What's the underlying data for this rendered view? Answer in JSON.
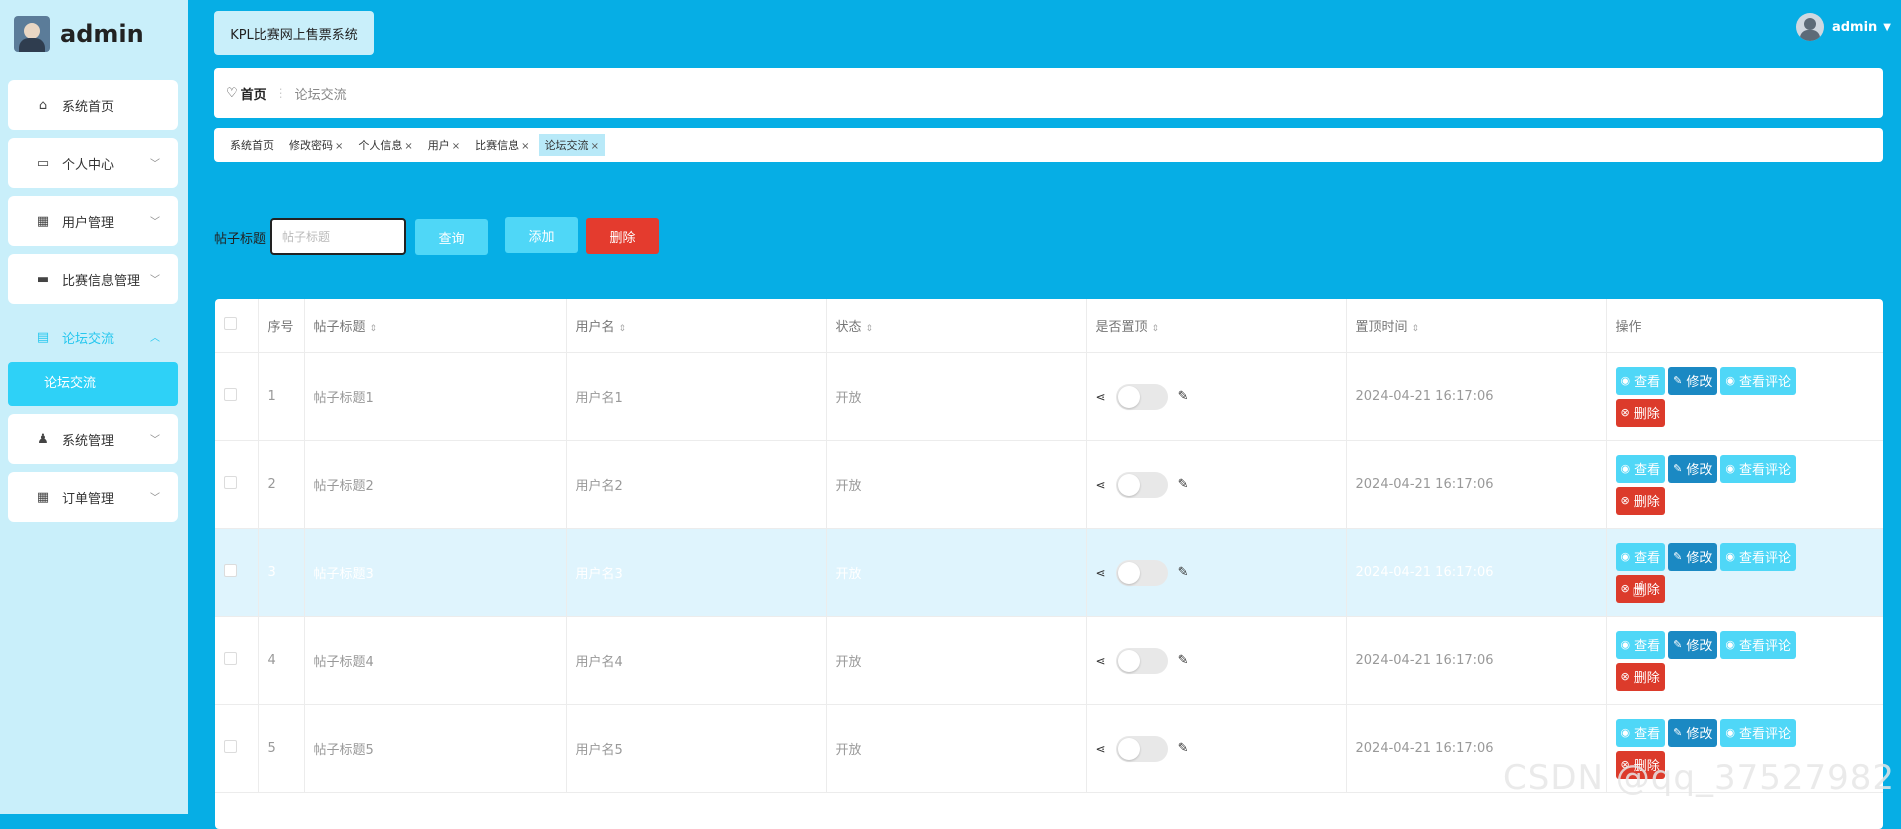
{
  "brand": {
    "name": "admin"
  },
  "sidebar": {
    "items": [
      {
        "label": "系统首页",
        "icon": "home-icon"
      },
      {
        "label": "个人中心",
        "icon": "wallet-icon",
        "arrow": "chevron-down-icon"
      },
      {
        "label": "用户管理",
        "icon": "grid-icon",
        "arrow": "chevron-down-icon"
      },
      {
        "label": "比赛信息管理",
        "icon": "briefcase-icon",
        "arrow": "chevron-down-icon"
      },
      {
        "label": "论坛交流",
        "icon": "clipboard-icon",
        "arrow": "chevron-up-icon"
      },
      {
        "label": "系统管理",
        "icon": "user-icon",
        "arrow": "chevron-down-icon"
      },
      {
        "label": "订单管理",
        "icon": "grid-icon",
        "arrow": "chevron-down-icon"
      }
    ],
    "submenu": {
      "label": "论坛交流"
    }
  },
  "header": {
    "system_title": "KPL比赛网上售票系统",
    "user": "admin"
  },
  "breadcrumb": {
    "home": "首页",
    "current": "论坛交流"
  },
  "tags": [
    {
      "label": "系统首页",
      "closable": false
    },
    {
      "label": "修改密码",
      "closable": true
    },
    {
      "label": "个人信息",
      "closable": true
    },
    {
      "label": "用户",
      "closable": true
    },
    {
      "label": "比赛信息",
      "closable": true
    },
    {
      "label": "论坛交流",
      "closable": true,
      "active": true
    }
  ],
  "search": {
    "label": "帖子标题",
    "placeholder": "帖子标题",
    "query_btn": "查询",
    "add_btn": "添加",
    "delete_btn": "删除"
  },
  "table": {
    "columns": [
      "序号",
      "帖子标题",
      "用户名",
      "状态",
      "是否置顶",
      "置顶时间",
      "操作"
    ],
    "rows": [
      {
        "no": "1",
        "title": "帖子标题1",
        "user": "用户名1",
        "status": "开放",
        "time": "2024-04-21 16:17:06"
      },
      {
        "no": "2",
        "title": "帖子标题2",
        "user": "用户名2",
        "status": "开放",
        "time": "2024-04-21 16:17:06"
      },
      {
        "no": "3",
        "title": "帖子标题3",
        "user": "用户名3",
        "status": "开放",
        "time": "2024-04-21 16:17:06"
      },
      {
        "no": "4",
        "title": "帖子标题4",
        "user": "用户名4",
        "status": "开放",
        "time": "2024-04-21 16:17:06"
      },
      {
        "no": "5",
        "title": "帖子标题5",
        "user": "用户名5",
        "status": "开放",
        "time": "2024-04-21 16:17:06"
      }
    ],
    "ops": {
      "view": "查看",
      "edit": "修改",
      "comments": "查看评论",
      "delete": "删除"
    }
  },
  "watermark": "CSDN @qq_37527982",
  "colors": {
    "background": "#06aee5",
    "sidebar": "#c9effa",
    "accent": "#4fd7f7",
    "danger": "#dc3b2b",
    "edit": "#1b89c3"
  }
}
